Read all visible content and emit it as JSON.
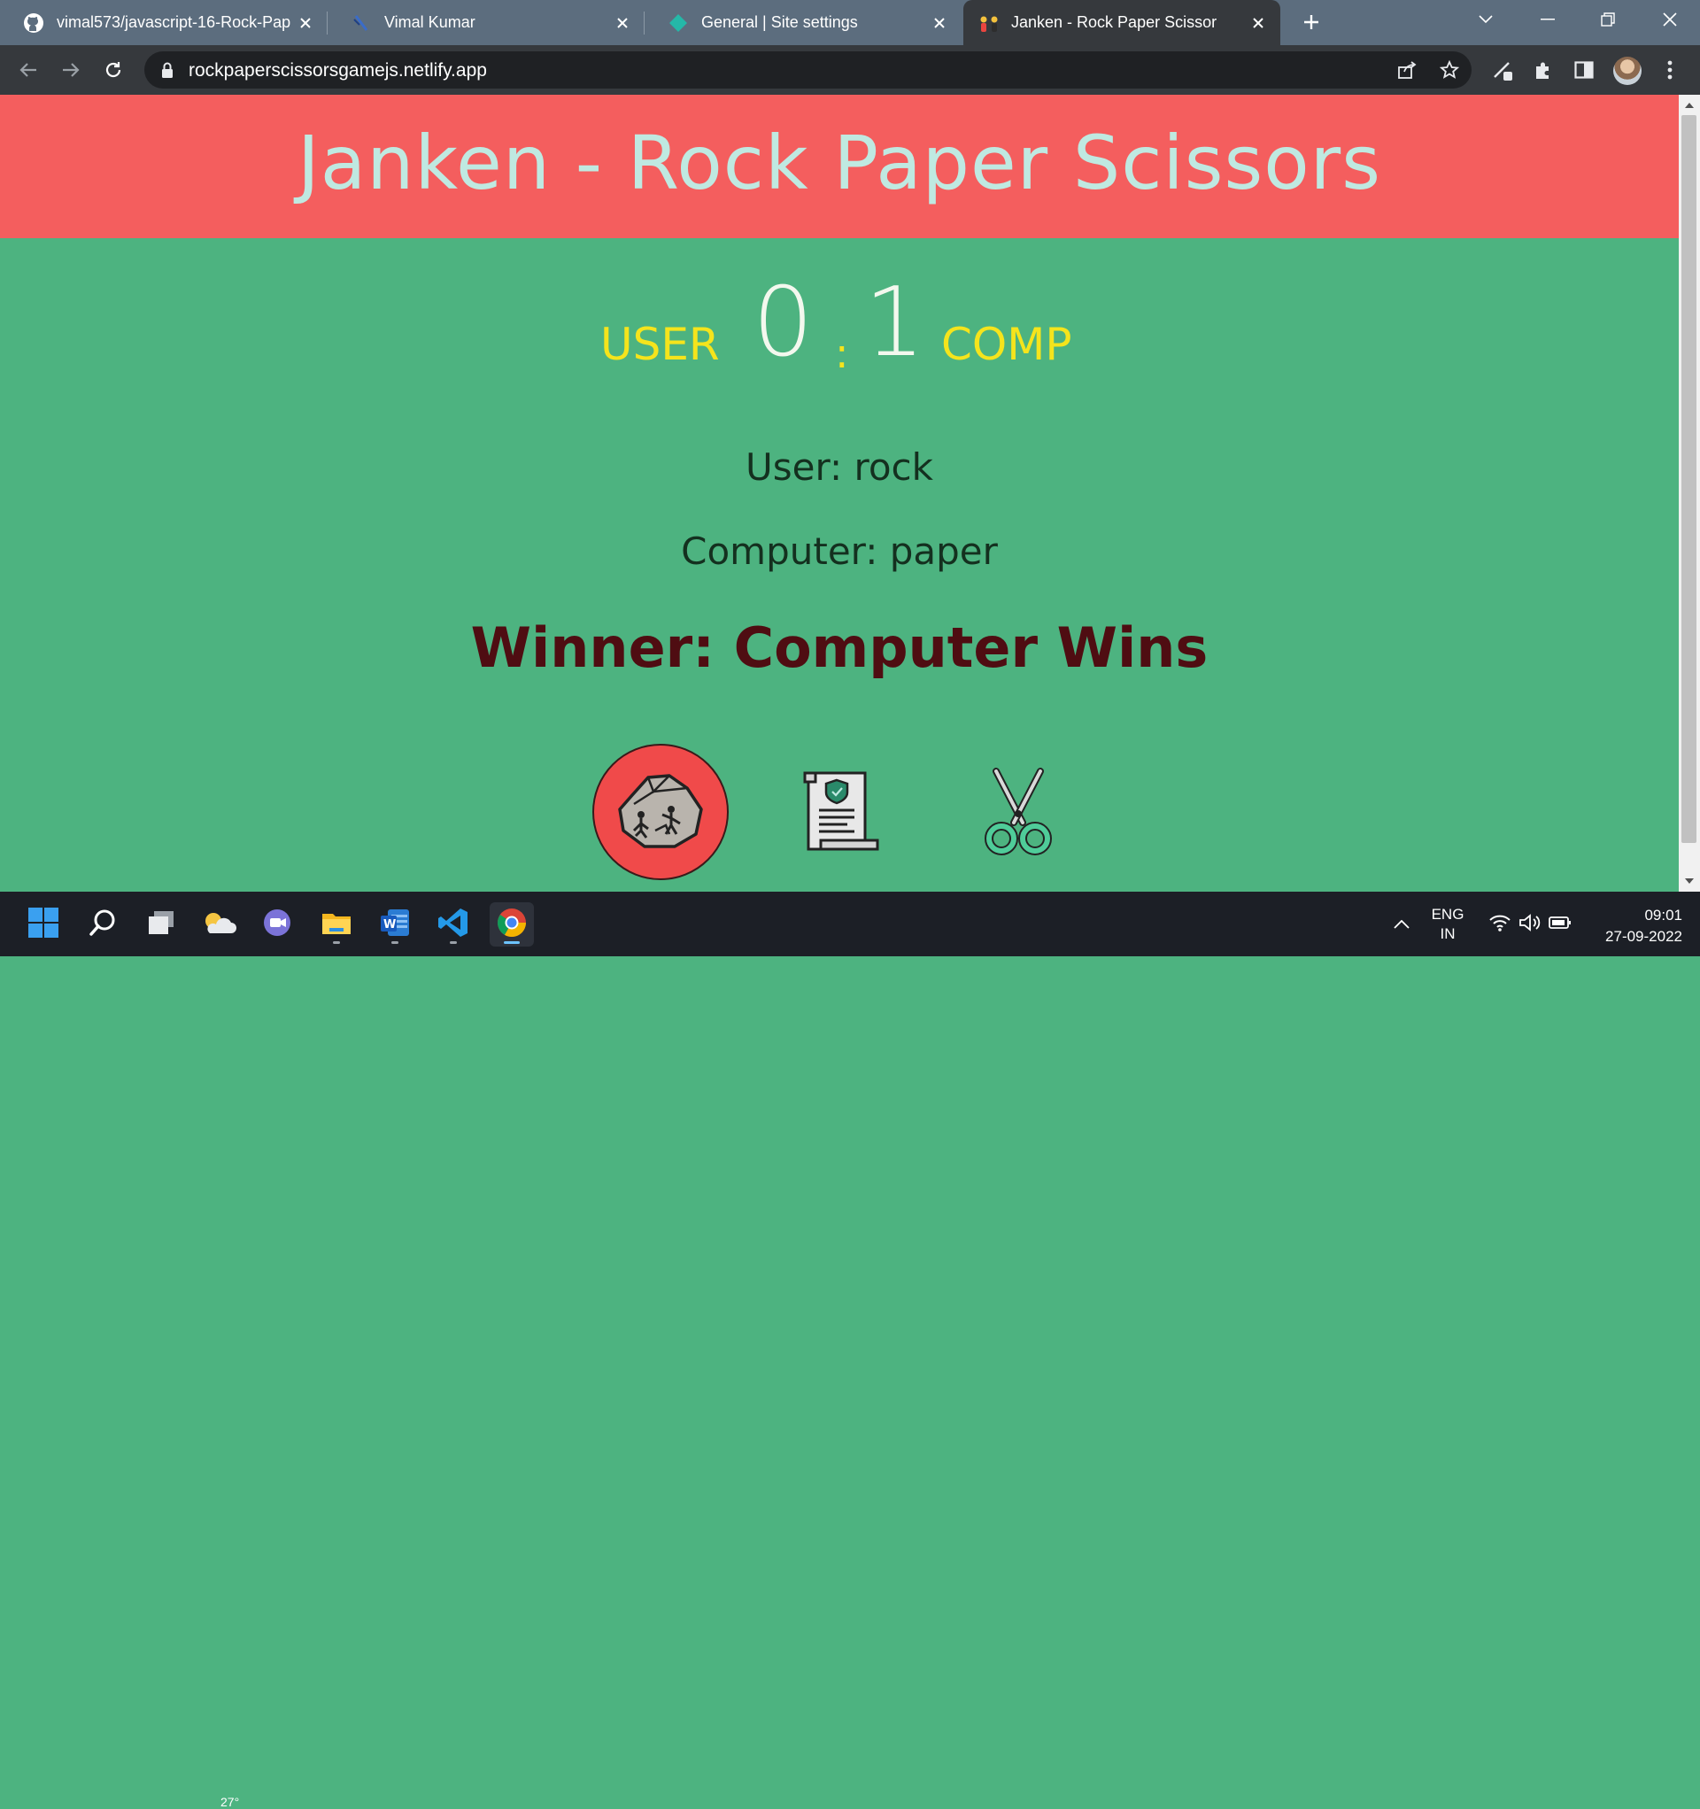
{
  "browser": {
    "tabs": [
      {
        "title": "vimal573/javascript-16-Rock-Pap",
        "icon": "github-icon"
      },
      {
        "title": "Vimal Kumar",
        "icon": "netlify-slash-icon"
      },
      {
        "title": "General | Site settings",
        "icon": "netlify-diamond-icon"
      },
      {
        "title": "Janken - Rock Paper Scissor",
        "icon": "hands-emoji-icon",
        "active": true
      }
    ],
    "url": "rockpaperscissorsgamejs.netlify.app"
  },
  "page": {
    "title": "Janken - Rock Paper Scissors",
    "score": {
      "user_label": "USER",
      "user_score": "0",
      "separator": ":",
      "comp_score": "1",
      "comp_label": "COMP"
    },
    "user_choice": "User: rock",
    "computer_choice": "Computer: paper",
    "winner": "Winner: Computer Wins",
    "choices": [
      {
        "name": "rock",
        "icon": "rock-icon",
        "selected": true
      },
      {
        "name": "paper",
        "icon": "paper-scroll-icon",
        "selected": false
      },
      {
        "name": "scissor",
        "icon": "scissors-icon",
        "selected": false
      }
    ]
  },
  "colors": {
    "header_bg": "#f45e5e",
    "header_text": "#bfe9e1",
    "page_bg": "#4db380",
    "score_label": "#f5e41c",
    "winner_text": "#4f0d12"
  },
  "taskbar": {
    "weather_temp": "27°",
    "language_top": "ENG",
    "language_bottom": "IN",
    "time": "09:01",
    "date": "27-09-2022"
  }
}
